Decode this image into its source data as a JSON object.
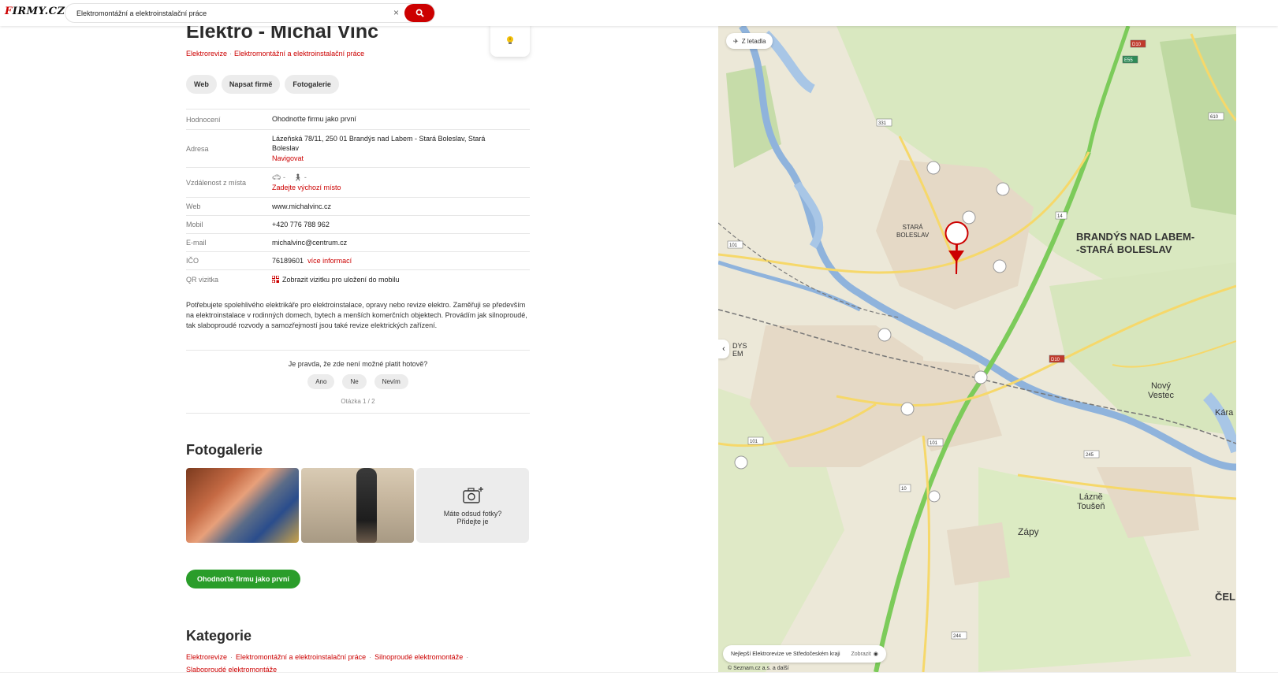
{
  "header": {
    "logo_text": "FIRMY.CZ",
    "search_value": "Elektromontážní a elektroinstalační práce",
    "clear_symbol": "×"
  },
  "company": {
    "name": "Elektro - Michal Vinc",
    "categories_top": [
      "Elektrorevize",
      "Elektromontážní a elektroinstalační práce"
    ]
  },
  "chips": [
    "Web",
    "Napsat firmě",
    "Fotogalerie"
  ],
  "info": {
    "rating_label": "Hodnocení",
    "rating_value": "Ohodnoťte firmu jako první",
    "address_label": "Adresa",
    "address_line1": "Lázeňská 78/11, 250 01 Brandýs nad Labem - Stará Boleslav, Stará",
    "address_line2": "Boleslav",
    "navigate": "Navigovat",
    "distance_label": "Vzdálenost z místa",
    "car_value": "-",
    "walk_value": "-",
    "distance_link": "Zadejte výchozí místo",
    "web_label": "Web",
    "web_value": "www.michalvinc.cz",
    "mobile_label": "Mobil",
    "mobile_value": "+420 776 788 962",
    "email_label": "E-mail",
    "email_value": "michalvinc@centrum.cz",
    "ico_label": "IČO",
    "ico_value": "76189601",
    "ico_more": "více informací",
    "qr_label": "QR vizitka",
    "qr_value": "Zobrazit vizitku pro uložení do mobilu"
  },
  "description": "Potřebujete spolehlivého elektrikáře pro elektroinstalace, opravy nebo revize elektro. Zaměřuji se především na elektroinstalace v rodinných domech, bytech a menších komerčních objektech. Provádím jak silnoproudé, tak slaboproudé rozvody a samozřejmostí jsou také revize elektrických zařízení.",
  "poll": {
    "question": "Je pravda, že zde není možné platit hotově?",
    "yes": "Ano",
    "no": "Ne",
    "dunno": "Nevím",
    "counter": "Otázka 1 / 2"
  },
  "gallery": {
    "title": "Fotogalerie",
    "add_line1": "Máte odsud fotky?",
    "add_line2": "Přidejte je"
  },
  "rate_button": "Ohodnoťte firmu jako první",
  "categories": {
    "title": "Kategorie",
    "items": [
      "Elektrorevize",
      "Elektromontážní a elektroinstalační práce",
      "Silnoproudé elektromontáže",
      "Slaboproudé elektromontáže"
    ]
  },
  "map": {
    "airport_pill": "Z letadla",
    "label_brandys_1": "BRANDÝS NAD LABEM-",
    "label_brandys_2": "-STARÁ BOLESLAV",
    "label_stara_1": "STARÁ",
    "label_stara_2": "BOLESLAV",
    "label_novy_1": "Nový",
    "label_novy_2": "Vestec",
    "label_lazne_1": "Lázně",
    "label_lazne_2": "Toušeň",
    "label_zapy": "Zápy",
    "label_kara": "Kára",
    "label_cel": "ČEL",
    "label_dys_1": "DYS",
    "label_dys_2": "EM",
    "bottom_pill_text": "Nejlepší Elektrorevize ve Středočeském kraji",
    "bottom_pill_action": "Zobrazit",
    "copyright": "© Seznam.cz a.s. a další",
    "road_numbers": [
      "D10",
      "E55",
      "610",
      "331",
      "101",
      "D10",
      "101",
      "245",
      "101",
      "14",
      "10",
      "244"
    ]
  },
  "colors": {
    "accent_red": "#cc0000",
    "rate_green": "#2a9d2a"
  }
}
